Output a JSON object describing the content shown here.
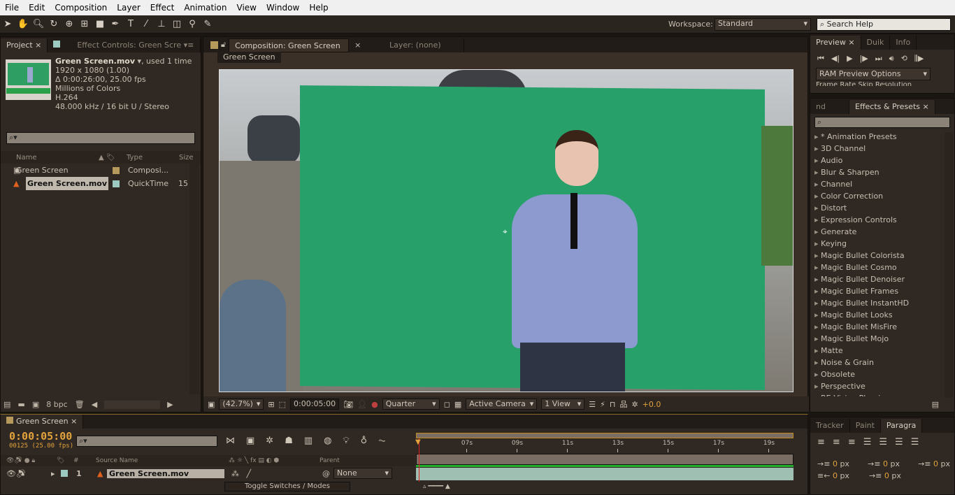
{
  "menu": [
    "File",
    "Edit",
    "Composition",
    "Layer",
    "Effect",
    "Animation",
    "View",
    "Window",
    "Help"
  ],
  "toolbar": {
    "workspace_label": "Workspace:",
    "workspace_value": "Standard",
    "search_placeholder": "Search Help"
  },
  "project": {
    "tabs": [
      "Project",
      "Effect Controls: Green Scre"
    ],
    "info": {
      "name": "Green Screen.mov",
      "used": ", used 1 time",
      "lines": [
        "1920 x 1080 (1.00)",
        "Δ 0:00:26:00, 25.00 fps",
        "Millions of Colors",
        "H.264",
        "48.000 kHz / 16 bit U / Stereo"
      ]
    },
    "columns": [
      "Name",
      "Type",
      "Size"
    ],
    "items": [
      {
        "name": "Green Screen",
        "type": "Composi...",
        "size": "",
        "label_color": "#b59a5c",
        "icon": "composition-icon"
      },
      {
        "name": "Green Screen.mov",
        "type": "QuickTime",
        "size": "15",
        "label_color": "#9cc9c0",
        "icon": "vlc-cone-icon",
        "selected": true
      }
    ],
    "bpc": "8 bpc"
  },
  "comp": {
    "tab": "Composition: Green Screen",
    "layer_tab": "Layer: (none)",
    "breadcrumb": "Green Screen",
    "zoom": "(42.7%)",
    "time": "0:00:05:00",
    "resolution": "Quarter",
    "camera": "Active Camera",
    "views": "1 View",
    "exposure": "+0.0"
  },
  "preview": {
    "tabs": [
      "Preview",
      "Duik",
      "Info"
    ],
    "ram_options": "RAM Preview Options",
    "cut_text": "Frame Rate    Skip    Resolution"
  },
  "effects": {
    "tabs": [
      "nd Wizz",
      "Effects & Presets"
    ],
    "items": [
      "* Animation Presets",
      "3D Channel",
      "Audio",
      "Blur & Sharpen",
      "Channel",
      "Color Correction",
      "Distort",
      "Expression Controls",
      "Generate",
      "Keying",
      "Magic Bullet Colorista",
      "Magic Bullet Cosmo",
      "Magic Bullet Denoiser",
      "Magic Bullet Frames",
      "Magic Bullet InstantHD",
      "Magic Bullet Looks",
      "Magic Bullet MisFire",
      "Magic Bullet Mojo",
      "Matte",
      "Noise & Grain",
      "Obsolete",
      "Perspective",
      "RE:Vision Plug-ins"
    ]
  },
  "paragraph": {
    "tabs": [
      "Tracker",
      "Paint",
      "Paragra"
    ],
    "values": [
      "0",
      "0",
      "0",
      "0",
      "0"
    ],
    "unit": "px"
  },
  "timeline": {
    "tab": "Green Screen",
    "timecode": "0:00:05:00",
    "frames": "00125 (25.00 fps)",
    "columns": {
      "num": "#",
      "source": "Source Name",
      "parent": "Parent"
    },
    "layer": {
      "num": "1",
      "name": "Green Screen.mov",
      "parent": "None"
    },
    "ruler": [
      "07s",
      "09s",
      "11s",
      "13s",
      "15s",
      "17s",
      "19s"
    ],
    "ruler_range_s": [
      5,
      20
    ],
    "current_time_s": 5,
    "toggle": "Toggle Switches / Modes"
  },
  "colors": {
    "accent": "#e2a23c",
    "layer_bar": "#9fbfb2",
    "green_bar": "#22b02c"
  }
}
